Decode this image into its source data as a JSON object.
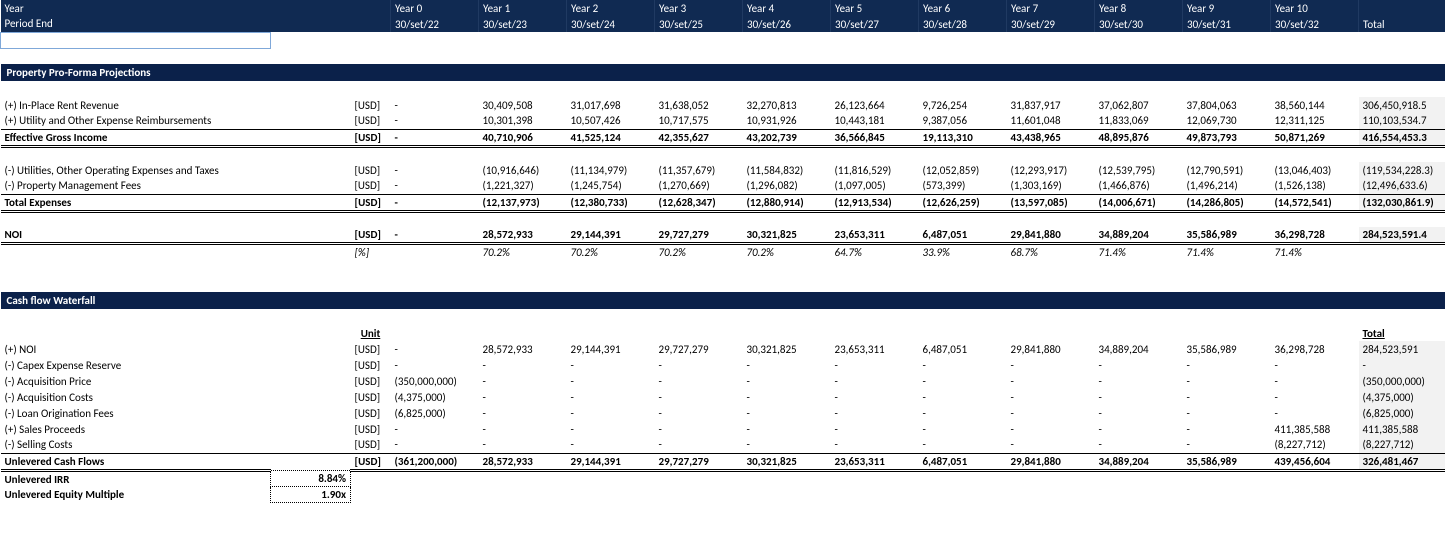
{
  "header": {
    "year_label": "Year",
    "period_label": "Period End",
    "years": [
      "Year 0",
      "Year 1",
      "Year 2",
      "Year 3",
      "Year 4",
      "Year 5",
      "Year 6",
      "Year 7",
      "Year 8",
      "Year 9",
      "Year 10"
    ],
    "dates": [
      "30/set/22",
      "30/set/23",
      "30/set/24",
      "30/set/25",
      "30/set/26",
      "30/set/27",
      "30/set/28",
      "30/set/29",
      "30/set/30",
      "30/set/31",
      "30/set/32"
    ],
    "total_label": "Total"
  },
  "section1_title": "Property Pro-Forma Projections",
  "section2_title": "Cash flow Waterfall",
  "unit_label": "Unit",
  "usd": "[USD]",
  "pct": "[%]",
  "rent": {
    "label": "(+) In-Place Rent Revenue",
    "vals": [
      "-",
      "30,409,508",
      "31,017,698",
      "31,638,052",
      "32,270,813",
      "26,123,664",
      "9,726,254",
      "31,837,917",
      "37,062,807",
      "37,804,063",
      "38,560,144"
    ],
    "total": "306,450,918.5"
  },
  "util_reimb": {
    "label": "(+) Utility and Other Expense Reimbursements",
    "vals": [
      "-",
      "10,301,398",
      "10,507,426",
      "10,717,575",
      "10,931,926",
      "10,443,181",
      "9,387,056",
      "11,601,048",
      "11,833,069",
      "12,069,730",
      "12,311,125"
    ],
    "total": "110,103,534.7"
  },
  "egi": {
    "label": "Effective Gross Income",
    "vals": [
      "-",
      "40,710,906",
      "41,525,124",
      "42,355,627",
      "43,202,739",
      "36,566,845",
      "19,113,310",
      "43,438,965",
      "48,895,876",
      "49,873,793",
      "50,871,269"
    ],
    "total": "416,554,453.3"
  },
  "util_exp": {
    "label": "(-) Utilities, Other Operating Expenses and Taxes",
    "vals": [
      "-",
      "(10,916,646)",
      "(11,134,979)",
      "(11,357,679)",
      "(11,584,832)",
      "(11,816,529)",
      "(12,052,859)",
      "(12,293,917)",
      "(12,539,795)",
      "(12,790,591)",
      "(13,046,403)"
    ],
    "total": "(119,534,228.3)"
  },
  "pm_fees": {
    "label": "(-) Property Management Fees",
    "vals": [
      "-",
      "(1,221,327)",
      "(1,245,754)",
      "(1,270,669)",
      "(1,296,082)",
      "(1,097,005)",
      "(573,399)",
      "(1,303,169)",
      "(1,466,876)",
      "(1,496,214)",
      "(1,526,138)"
    ],
    "total": "(12,496,633.6)"
  },
  "tot_exp": {
    "label": "Total Expenses",
    "vals": [
      "-",
      "(12,137,973)",
      "(12,380,733)",
      "(12,628,347)",
      "(12,880,914)",
      "(12,913,534)",
      "(12,626,259)",
      "(13,597,085)",
      "(14,006,671)",
      "(14,286,805)",
      "(14,572,541)"
    ],
    "total": "(132,030,861.9)"
  },
  "noi": {
    "label": "NOI",
    "vals": [
      "-",
      "28,572,933",
      "29,144,391",
      "29,727,279",
      "30,321,825",
      "23,653,311",
      "6,487,051",
      "29,841,880",
      "34,889,204",
      "35,586,989",
      "36,298,728"
    ],
    "total": "284,523,591.4"
  },
  "noi_pct": {
    "vals": [
      "",
      "70.2%",
      "70.2%",
      "70.2%",
      "70.2%",
      "64.7%",
      "33.9%",
      "68.7%",
      "71.4%",
      "71.4%",
      "71.4%"
    ]
  },
  "wf_noi": {
    "label": "(+) NOI",
    "vals": [
      "-",
      "28,572,933",
      "29,144,391",
      "29,727,279",
      "30,321,825",
      "23,653,311",
      "6,487,051",
      "29,841,880",
      "34,889,204",
      "35,586,989",
      "36,298,728"
    ],
    "total": "284,523,591"
  },
  "capex": {
    "label": "(-) Capex Expense Reserve",
    "vals": [
      "-",
      "-",
      "-",
      "-",
      "-",
      "-",
      "-",
      "-",
      "-",
      "-",
      "-"
    ],
    "total": "-"
  },
  "acq_price": {
    "label": "(-) Acquisition Price",
    "vals": [
      "(350,000,000)",
      "-",
      "-",
      "-",
      "-",
      "-",
      "-",
      "-",
      "-",
      "-",
      "-"
    ],
    "total": "(350,000,000)"
  },
  "acq_costs": {
    "label": "(-) Acquisition Costs",
    "vals": [
      "(4,375,000)",
      "-",
      "-",
      "-",
      "-",
      "-",
      "-",
      "-",
      "-",
      "-",
      "-"
    ],
    "total": "(4,375,000)"
  },
  "loan_fees": {
    "label": "(-) Loan Origination Fees",
    "vals": [
      "(6,825,000)",
      "-",
      "-",
      "-",
      "-",
      "-",
      "-",
      "-",
      "-",
      "-",
      "-"
    ],
    "total": "(6,825,000)"
  },
  "sales": {
    "label": "(+) Sales Proceeds",
    "vals": [
      "-",
      "-",
      "-",
      "-",
      "-",
      "-",
      "-",
      "-",
      "-",
      "-",
      "411,385,588"
    ],
    "total": "411,385,588"
  },
  "selling": {
    "label": "(-) Selling Costs",
    "vals": [
      "-",
      "-",
      "-",
      "-",
      "-",
      "-",
      "-",
      "-",
      "-",
      "-",
      "(8,227,712)"
    ],
    "total": "(8,227,712)"
  },
  "ucf": {
    "label": "Unlevered Cash Flows",
    "vals": [
      "(361,200,000)",
      "28,572,933",
      "29,144,391",
      "29,727,279",
      "30,321,825",
      "23,653,311",
      "6,487,051",
      "29,841,880",
      "34,889,204",
      "35,586,989",
      "439,456,604"
    ],
    "total": "326,481,467"
  },
  "irr": {
    "label": "Unlevered IRR",
    "val": "8.84%"
  },
  "em": {
    "label": "Unlevered Equity Multiple",
    "val": "1.90x"
  }
}
